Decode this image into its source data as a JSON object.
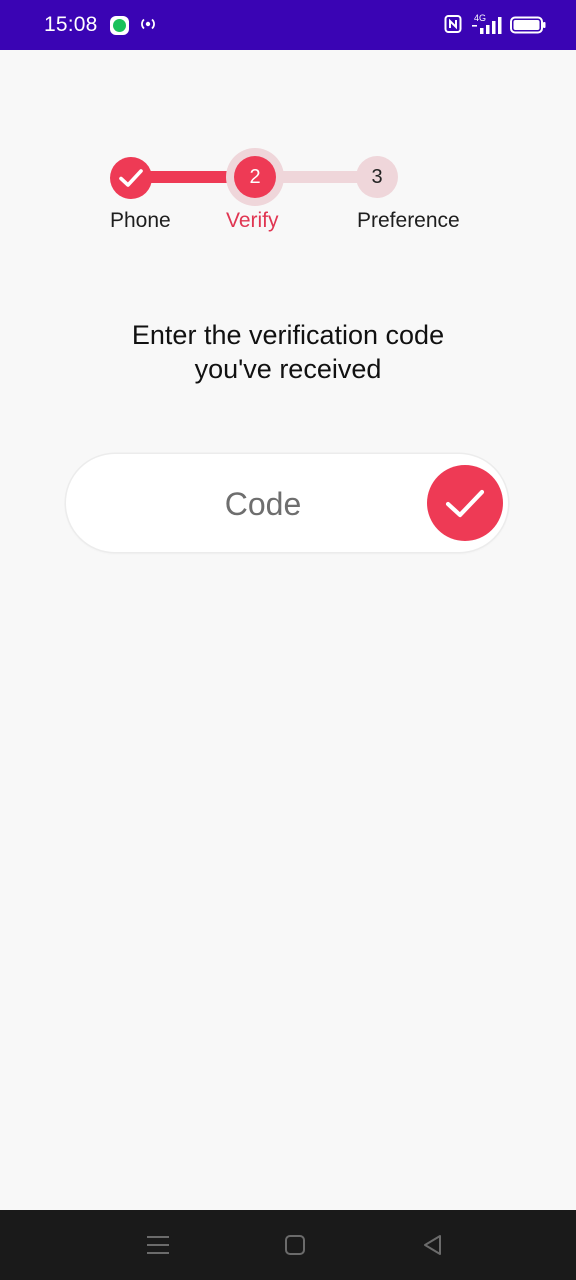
{
  "status_bar": {
    "time": "15:08",
    "background": "#3a04b4",
    "icons": [
      "chat-app-icon",
      "hotspot-icon",
      "nfc-icon",
      "signal-4g-icon",
      "battery-icon"
    ],
    "network": "4G"
  },
  "stepper": {
    "steps": [
      {
        "label": "Phone",
        "number": "1",
        "state": "completed"
      },
      {
        "label": "Verify",
        "number": "2",
        "state": "active"
      },
      {
        "label": "Preference",
        "number": "3",
        "state": "pending"
      }
    ],
    "accent_color": "#ee3a55",
    "pending_color": "#efd6da"
  },
  "headline": {
    "line1": "Enter the verification code",
    "line2": "you've received"
  },
  "code_field": {
    "placeholder": "Code",
    "value": "",
    "submit_icon": "check-icon"
  },
  "nav_bar": {
    "icons": [
      "menu-icon",
      "home-icon",
      "back-icon"
    ]
  }
}
